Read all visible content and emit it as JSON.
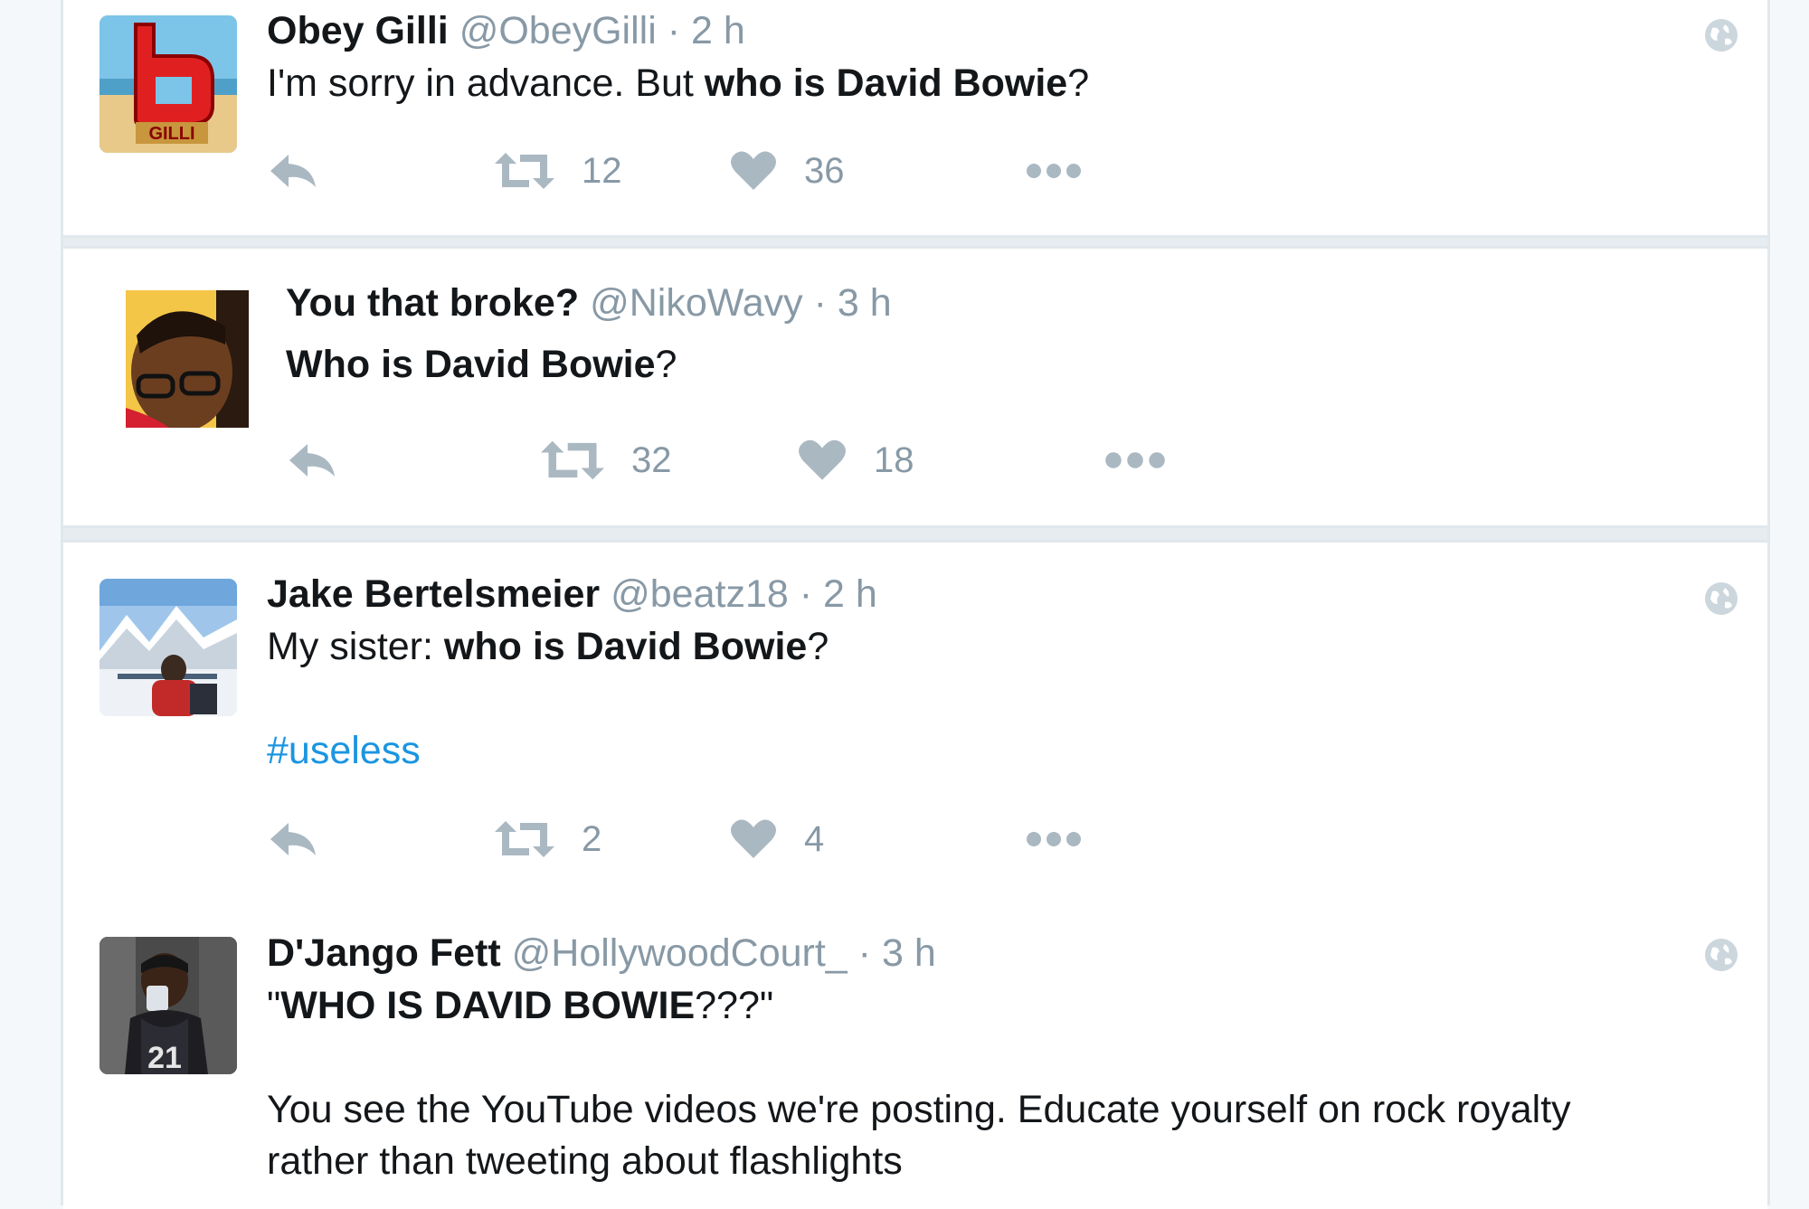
{
  "tweets": [
    {
      "name": "Obey Gilli",
      "handle": "@ObeyGilli",
      "sep": "·",
      "time": "2 h",
      "body_plain_1": "I'm sorry in advance. But ",
      "body_bold_1": "who is David Bowie",
      "body_plain_2": "?",
      "retweets": "12",
      "likes": "36",
      "avatar_text": "GILLI",
      "icons": [
        "reply-icon",
        "retweet-icon",
        "heart-icon",
        "more-icon",
        "globe-icon"
      ]
    },
    {
      "name": "You that broke?",
      "handle": "@NikoWavy",
      "sep": "·",
      "time": "3 h",
      "body_bold_1": "Who is David Bowie",
      "body_plain_2": "?",
      "retweets": "32",
      "likes": "18",
      "icons": [
        "reply-icon",
        "retweet-icon",
        "heart-icon",
        "more-icon"
      ]
    },
    {
      "name": "Jake Bertelsmeier",
      "handle": "@beatz18",
      "sep": "·",
      "time": "2 h",
      "body_plain_1": "My sister: ",
      "body_bold_1": "who is David Bowie",
      "body_plain_2": "?",
      "hashtag": "#useless",
      "retweets": "2",
      "likes": "4",
      "icons": [
        "reply-icon",
        "retweet-icon",
        "heart-icon",
        "more-icon",
        "globe-icon"
      ]
    },
    {
      "name": "D'Jango Fett",
      "handle": "@HollywoodCourt_",
      "sep": "·",
      "time": "3 h",
      "body_quote_open": "\"",
      "body_bold_1": "WHO IS DAVID BOWIE",
      "body_quote_close": "???\"",
      "body_line_2": "You see the YouTube videos we're posting. Educate yourself on rock royalty",
      "body_line_3": "rather than tweeting about flashlights",
      "jersey_number": "21",
      "icons": [
        "globe-icon"
      ]
    }
  ],
  "colors": {
    "name": "#14171a",
    "muted": "#8899a6",
    "link": "#1b95e0",
    "divider": "#e1e8ed",
    "background": "#f5f8fa"
  }
}
